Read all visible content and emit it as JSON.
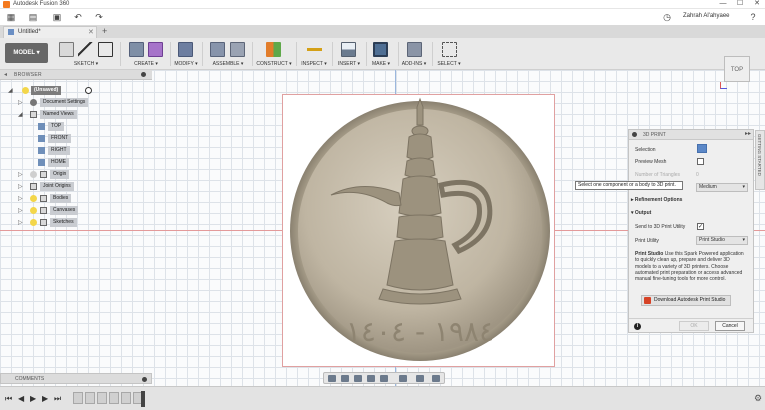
{
  "window": {
    "title": "Autodesk Fusion 360",
    "minimize": "—",
    "maximize": "☐",
    "close": "✕"
  },
  "appbar": {
    "user_name": "Zahrah Al'ahyaee"
  },
  "tabs": [
    {
      "label": "Untitled*",
      "close": "✕"
    }
  ],
  "tab_add": "+",
  "toolbar": {
    "workspace": "MODEL ▾",
    "groups": [
      {
        "label": "SKETCH ▾"
      },
      {
        "label": "CREATE ▾"
      },
      {
        "label": "MODIFY ▾"
      },
      {
        "label": "ASSEMBLE ▾"
      },
      {
        "label": "CONSTRUCT ▾"
      },
      {
        "label": "INSPECT ▾"
      },
      {
        "label": "INSERT ▾"
      },
      {
        "label": "MAKE ▾"
      },
      {
        "label": "ADD-INS ▾"
      },
      {
        "label": "SELECT ▾"
      }
    ]
  },
  "browser": {
    "header": "BROWSER",
    "items": [
      {
        "label": "(Unsaved)"
      },
      {
        "label": "Document Settings"
      },
      {
        "label": "Named Views"
      },
      {
        "label": "TOP"
      },
      {
        "label": "FRONT"
      },
      {
        "label": "RIGHT"
      },
      {
        "label": "HOME"
      },
      {
        "label": "Origin"
      },
      {
        "label": "Joint Origins"
      },
      {
        "label": "Bodies"
      },
      {
        "label": "Canvases"
      },
      {
        "label": "Sketches"
      }
    ]
  },
  "comments": {
    "header": "COMMENTS"
  },
  "viewcube": {
    "face": "TOP"
  },
  "getting_started": "GETTING STARTED",
  "print_dialog": {
    "title": "3D PRINT",
    "selection_label": "Selection",
    "preview_mesh_label": "Preview Mesh",
    "num_triangles_label": "Number of Triangles",
    "num_triangles_value": "0",
    "refinement_value": "Medium",
    "refinement_options_label": "Refinement Options",
    "output_label": "Output",
    "send_to_utility_label": "Send to 3D Print Utility",
    "send_to_utility_checked": "✓",
    "print_utility_label": "Print Utility",
    "print_utility_value": "Print Studio",
    "description_bold": "Print Studio",
    "description": " Use this Spark Powered application to quickly clean up, prepare and deliver 3D models to a variety of 3D printers. Choose automated print preparation or access advanced manual fine-tuning tools for more control.",
    "download_label": "Download Autodesk Print Studio",
    "ok_label": "OK",
    "cancel_label": "Cancel"
  },
  "tooltip": "Select one component or a body to 3D print.",
  "coin": {
    "inscription": "١٩٨٤ - ١٤٠٤"
  }
}
